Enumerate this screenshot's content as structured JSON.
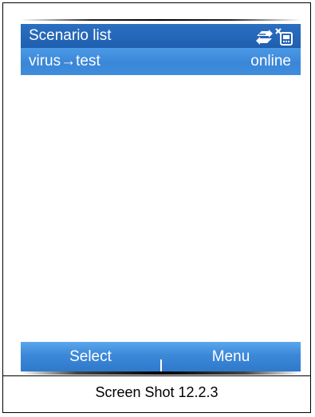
{
  "header": {
    "title": "Scenario list",
    "status_icons": [
      "network-sync-icon",
      "no-signal-icon"
    ]
  },
  "list": {
    "items": [
      {
        "name": "virus→test",
        "status": "online",
        "selected": true
      }
    ]
  },
  "softkeys": {
    "left_label": "Select",
    "right_label": "Menu"
  },
  "caption": "Screen Shot 12.2.3",
  "colors": {
    "title_bar": "#2265b6",
    "selection": "#3f8ddc",
    "softkey_bar": "#3c88d8",
    "text_on_blue": "#ffffff"
  }
}
